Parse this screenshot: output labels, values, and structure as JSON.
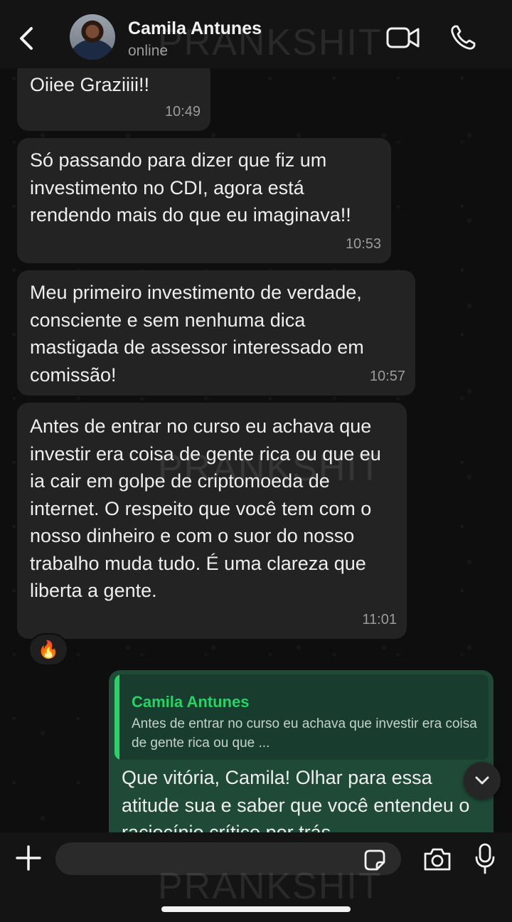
{
  "header": {
    "contact_name": "Camila Antunes",
    "status": "online",
    "back_icon": "chevron-left-icon",
    "video_icon": "video-camera-icon",
    "call_icon": "phone-icon"
  },
  "watermark": "PRANKSHIT",
  "messages": [
    {
      "text": "Oiiee Graziiii!!",
      "time": "10:49"
    },
    {
      "text": "Só passando para dizer que fiz um investimento no CDI, agora está rendendo mais do que eu imaginava!!",
      "time": "10:53"
    },
    {
      "text": "Meu primeiro investimento de verdade, consciente e sem nenhuma dica mastigada de assessor interessado em comissão!",
      "time": "10:57"
    },
    {
      "text": "Antes de entrar no curso eu achava que investir era coisa de gente rica ou que eu ia cair em golpe de criptomoeda de internet. O respeito que você tem com o nosso dinheiro e com o suor do nosso trabalho muda tudo. É uma clareza que liberta a gente.",
      "time": "11:01",
      "reaction": "🔥"
    }
  ],
  "outgoing": {
    "quote_name": "Camila Antunes",
    "quote_text": "Antes de entrar no curso eu achava que investir era coisa de gente rica ou que ...",
    "text": "Que vitória, Camila! Olhar para essa atitude sua e saber que você entendeu o raciocínio crítico por trás"
  },
  "composer": {
    "placeholder": "",
    "icons": [
      "plus-icon",
      "sticker-icon",
      "camera-icon",
      "microphone-icon"
    ]
  },
  "colors": {
    "incoming_bubble": "#232323",
    "outgoing_bubble": "#1f4a38",
    "accent": "#25d366"
  }
}
